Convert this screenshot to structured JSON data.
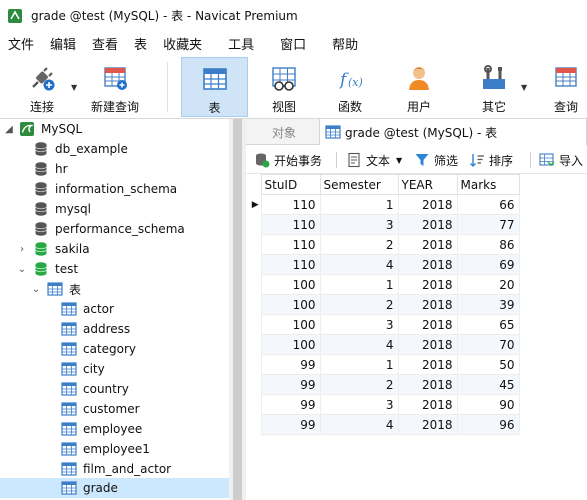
{
  "window": {
    "title": "grade @test (MySQL) - 表 - Navicat Premium"
  },
  "menu": [
    "文件",
    "编辑",
    "查看",
    "表",
    "收藏夹",
    "工具",
    "窗口",
    "帮助"
  ],
  "toolbar": {
    "connect": "连接",
    "new_query": "新建查询",
    "table": "表",
    "view": "视图",
    "function": "函数",
    "user": "用户",
    "other": "其它",
    "query": "查询"
  },
  "tree": {
    "connection": "MySQL",
    "databases": [
      "db_example",
      "hr",
      "information_schema",
      "mysql",
      "performance_schema",
      "sakila",
      "test"
    ],
    "tables_group": "表",
    "tables": [
      "actor",
      "address",
      "category",
      "city",
      "country",
      "customer",
      "employee",
      "employee1",
      "film_and_actor",
      "grade"
    ]
  },
  "tabs": {
    "objects": "对象",
    "grade_tab": "grade @test (MySQL) - 表"
  },
  "subtoolbar": {
    "begin_transaction": "开始事务",
    "text": "文本",
    "filter": "筛选",
    "sort": "排序",
    "import": "导入"
  },
  "grid": {
    "columns": [
      "StuID",
      "Semester",
      "YEAR",
      "Marks"
    ],
    "rows": [
      [
        "110",
        "1",
        "2018",
        "66"
      ],
      [
        "110",
        "3",
        "2018",
        "77"
      ],
      [
        "110",
        "2",
        "2018",
        "86"
      ],
      [
        "110",
        "4",
        "2018",
        "69"
      ],
      [
        "100",
        "1",
        "2018",
        "20"
      ],
      [
        "100",
        "2",
        "2018",
        "39"
      ],
      [
        "100",
        "3",
        "2018",
        "65"
      ],
      [
        "100",
        "4",
        "2018",
        "70"
      ],
      [
        "99",
        "1",
        "2018",
        "50"
      ],
      [
        "99",
        "2",
        "2018",
        "45"
      ],
      [
        "99",
        "3",
        "2018",
        "90"
      ],
      [
        "99",
        "4",
        "2018",
        "96"
      ]
    ]
  },
  "colors": {
    "accent": "#1e6fc9",
    "db_green": "#27a844",
    "selection": "#cce8ff"
  }
}
